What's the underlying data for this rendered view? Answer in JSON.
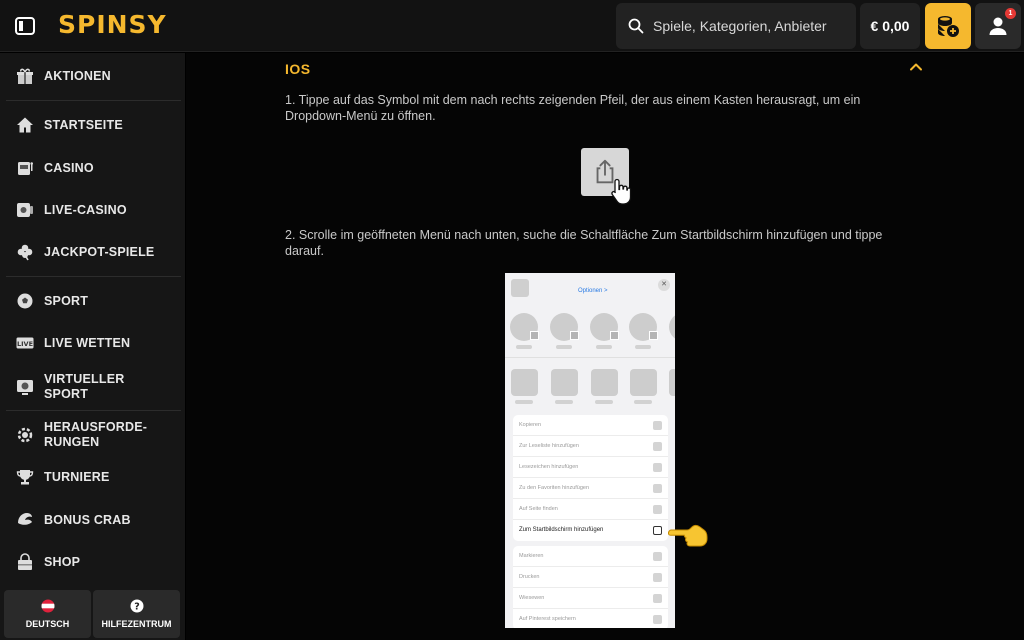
{
  "header": {
    "logo": "SPINSY",
    "search_placeholder": "Spiele, Kategorien, Anbieter",
    "balance": "€ 0,00",
    "notification_count": "1"
  },
  "sidebar": {
    "items": [
      {
        "label": "AKTIONEN",
        "icon": "gift-icon"
      },
      {
        "label": "STARTSEITE",
        "icon": "home-icon"
      },
      {
        "label": "CASINO",
        "icon": "slot-machine-icon"
      },
      {
        "label": "LIVE-CASINO",
        "icon": "live-casino-icon"
      },
      {
        "label": "JACKPOT-SPIELE",
        "icon": "clover-icon"
      },
      {
        "label": "SPORT",
        "icon": "soccer-ball-icon"
      },
      {
        "label": "LIVE WETTEN",
        "icon": "live-badge-icon"
      },
      {
        "label": "VIRTUELLER\nSPORT",
        "icon": "virtual-sport-icon"
      },
      {
        "label": "HERAUSFORDE-\nRUNGEN",
        "icon": "challenge-icon"
      },
      {
        "label": "TURNIERE",
        "icon": "trophy-icon"
      },
      {
        "label": "BONUS CRAB",
        "icon": "crab-claw-icon"
      },
      {
        "label": "SHOP",
        "icon": "shop-icon"
      }
    ],
    "language_label": "DEUTSCH",
    "help_label": "HILFEZENTRUM"
  },
  "main": {
    "section_title": "IOS",
    "step1": "1. Tippe auf das Symbol mit dem nach rechts zeigenden Pfeil, der aus einem Kasten herausragt, um ein Dropdown-Menü zu öffnen.",
    "step2": "2. Scrolle im geöffneten Menü nach unten, suche die Schaltfläche Zum Startbildschirm hinzufügen und tippe darauf.",
    "phone": {
      "options_label": "Optionen >",
      "rows_top": [
        "Kopieren",
        "Zur Leseliste hinzufügen",
        "Lesezeichen hinzufügen",
        "Zu den Favoriten hinzufügen",
        "Auf Seite finden"
      ],
      "highlight_row": "Zum Startbildschirm hinzufügen",
      "rows_bottom": [
        "Markieren",
        "Drucken",
        "Wiesewen",
        "Auf Pinterest speichern"
      ]
    }
  },
  "colors": {
    "accent": "#f5b82e",
    "background": "#000000",
    "sidebar": "#161616",
    "notification": "#e53935"
  }
}
